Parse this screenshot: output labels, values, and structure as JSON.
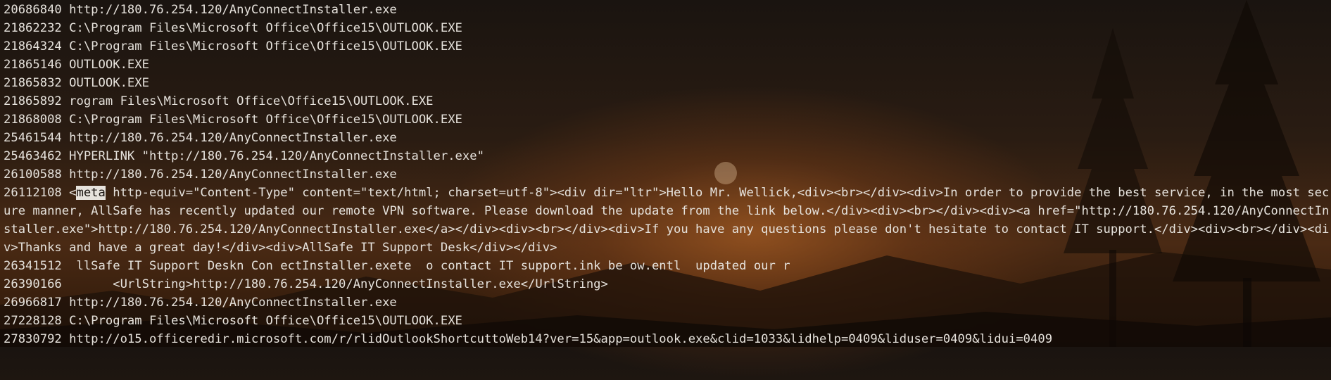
{
  "lines": [
    {
      "text": "20686840 http://180.76.254.120/AnyConnectInstaller.exe"
    },
    {
      "text": "21862232 C:\\Program Files\\Microsoft Office\\Office15\\OUTLOOK.EXE"
    },
    {
      "text": "21864324 C:\\Program Files\\Microsoft Office\\Office15\\OUTLOOK.EXE"
    },
    {
      "text": "21865146 OUTLOOK.EXE"
    },
    {
      "text": "21865832 OUTLOOK.EXE"
    },
    {
      "text": "21865892 rogram Files\\Microsoft Office\\Office15\\OUTLOOK.EXE"
    },
    {
      "text": "21868008 C:\\Program Files\\Microsoft Office\\Office15\\OUTLOOK.EXE"
    },
    {
      "text": "25461544 http://180.76.254.120/AnyConnectInstaller.exe"
    },
    {
      "text": "25463462 HYPERLINK \"http://180.76.254.120/AnyConnectInstaller.exe\""
    },
    {
      "text": "26100588 http://180.76.254.120/AnyConnectInstaller.exe"
    },
    {
      "prefix": "26112108 <",
      "highlight": "meta",
      "suffix": " http-equiv=\"Content-Type\" content=\"text/html; charset=utf-8\"><div dir=\"ltr\">Hello Mr. Wellick,<div><br></div><div>In order to provide the best service, in the most secure manner, AllSafe has recently updated our remote VPN software. Please download the update from the link below.</div><div><br></div><div><a href=\"http://180.76.254.120/AnyConnectInstaller.exe\">http://180.76.254.120/AnyConnectInstaller.exe</a></div><div><br></div><div>If you have any questions please don't hesitate to contact IT support.</div><div><br></div><div>Thanks and have a great day!</div><div>AllSafe IT Support Desk</div></div>"
    },
    {
      "text": "26341512  llSafe IT Support Deskn Con ectInstaller.exete  o contact IT support.ink be ow.entl  updated our r"
    },
    {
      "text": "26390166       <UrlString>http://180.76.254.120/AnyConnectInstaller.exe</UrlString>"
    },
    {
      "text": "26966817 http://180.76.254.120/AnyConnectInstaller.exe"
    },
    {
      "text": "27228128 C:\\Program Files\\Microsoft Office\\Office15\\OUTLOOK.EXE"
    },
    {
      "text": "27830792 http://o15.officeredir.microsoft.com/r/rlidOutlookShortcuttoWeb14?ver=15&app=outlook.exe&clid=1033&lidhelp=0409&liduser=0409&lidui=0409"
    }
  ]
}
